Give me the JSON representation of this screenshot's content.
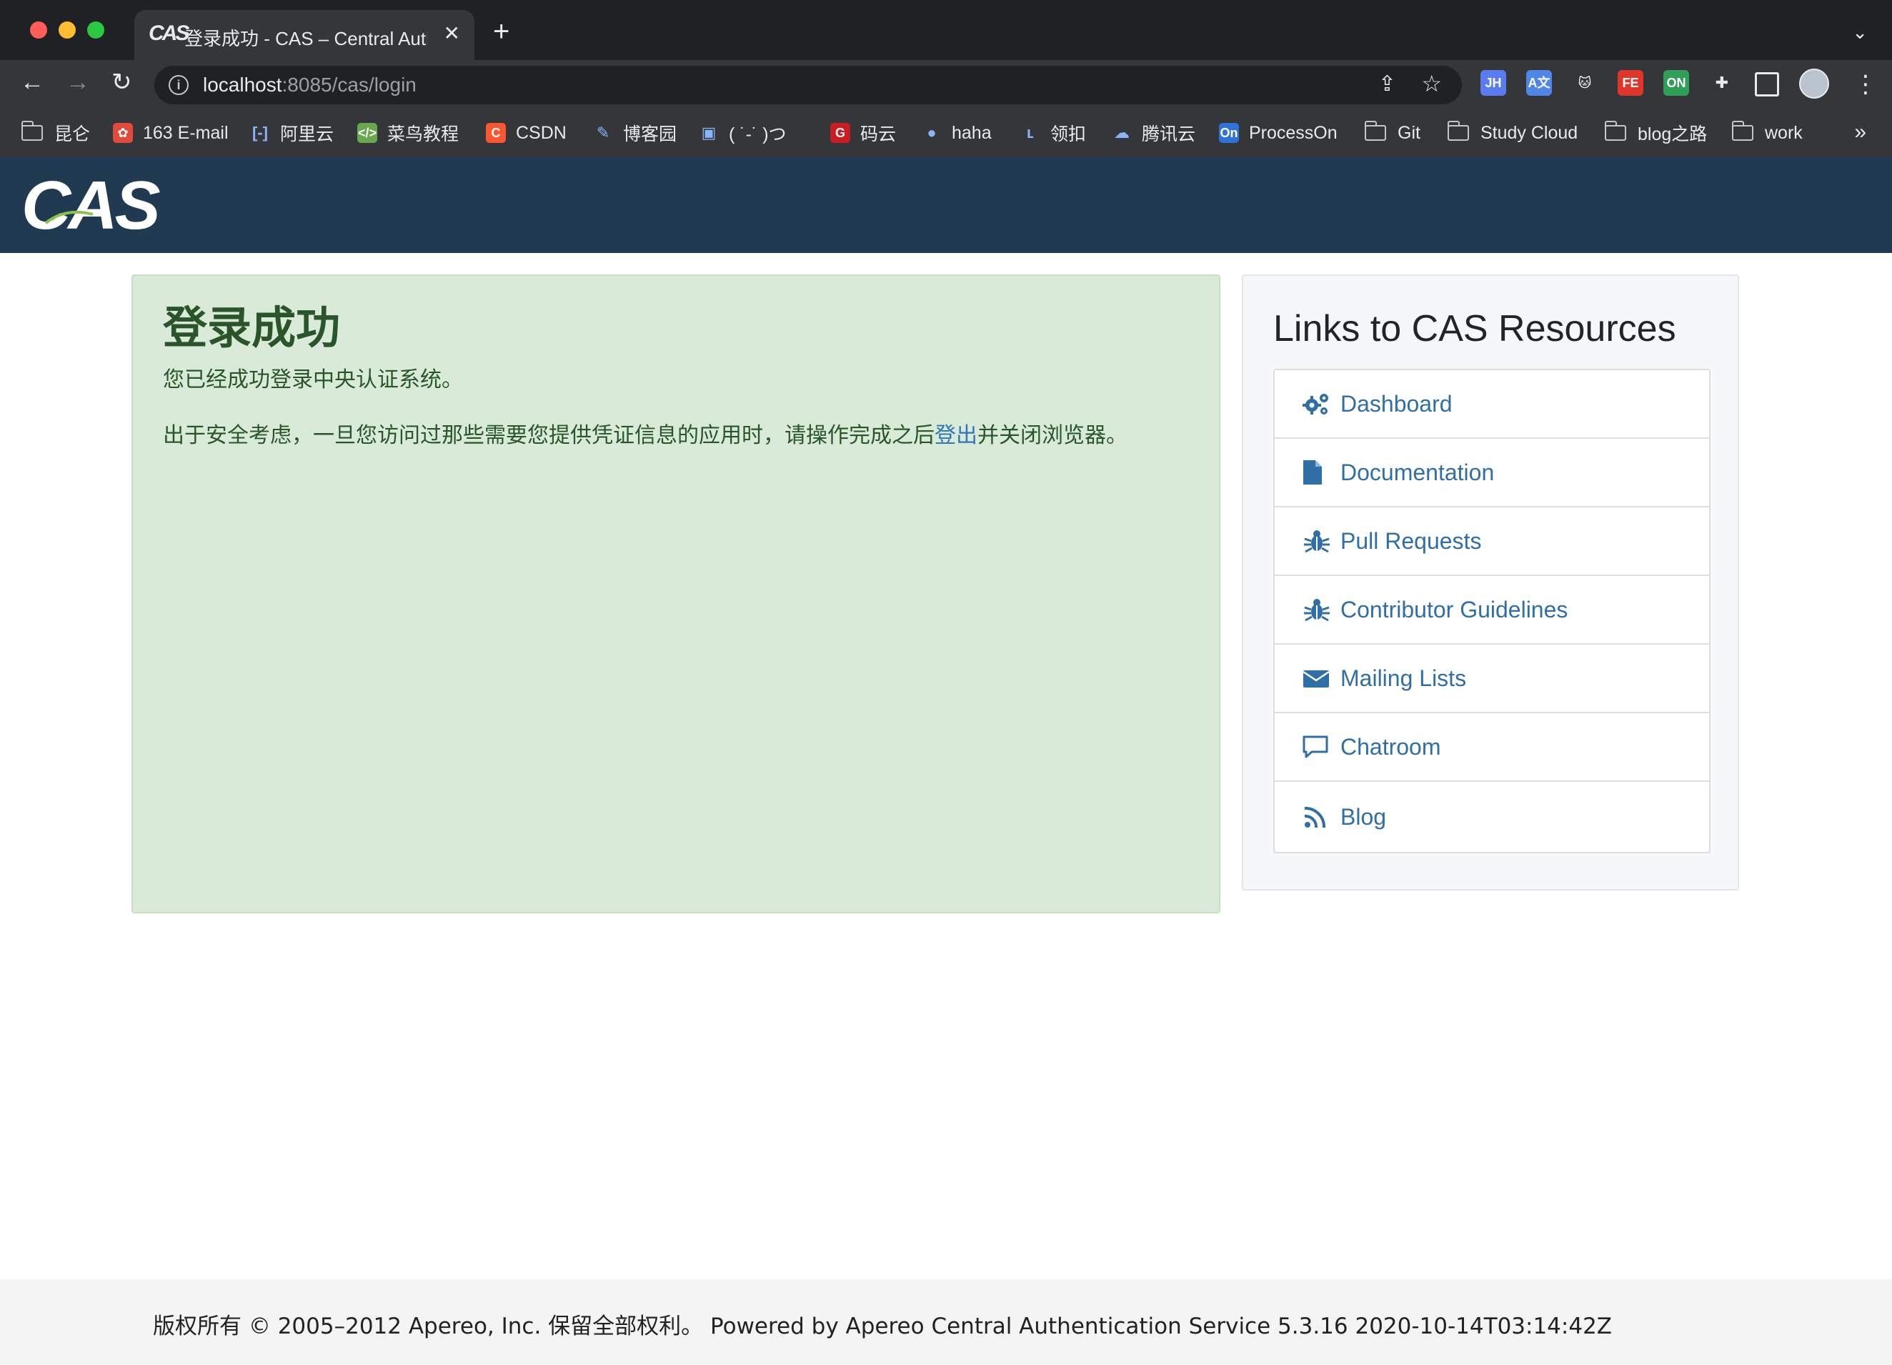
{
  "browser": {
    "tab_title": "登录成功 - CAS – Central Authe",
    "tab_favicon": "CAS",
    "url_host": "localhost",
    "url_rest": ":8085/cas/login",
    "bookmarks": [
      {
        "label": "昆仑",
        "icon": "folder-icon"
      },
      {
        "label": "163 E-mail",
        "icon": "163-icon"
      },
      {
        "label": "阿里云",
        "icon": "aliyun-icon"
      },
      {
        "label": "菜鸟教程",
        "icon": "runoob-icon"
      },
      {
        "label": "CSDN",
        "icon": "csdn-icon"
      },
      {
        "label": "博客园",
        "icon": "cnblogs-icon"
      },
      {
        "label": "( ˙-˙ )つ",
        "icon": "bilibili-icon"
      },
      {
        "label": "码云",
        "icon": "gitee-icon"
      },
      {
        "label": "haha",
        "icon": "github-icon"
      },
      {
        "label": "领扣",
        "icon": "leetcode-icon"
      },
      {
        "label": "腾讯云",
        "icon": "tencent-cloud-icon"
      },
      {
        "label": "ProcessOn",
        "icon": "processon-icon"
      },
      {
        "label": "Git",
        "icon": "folder-icon"
      },
      {
        "label": "Study Cloud",
        "icon": "folder-icon"
      },
      {
        "label": "blog之路",
        "icon": "folder-icon"
      },
      {
        "label": "work",
        "icon": "folder-icon"
      }
    ],
    "extensions": [
      {
        "name": "jh-extension-icon",
        "text": "JH",
        "color": "#5b7cf0"
      },
      {
        "name": "translate-extension-icon",
        "text": "A文",
        "color": "#4f86e8"
      },
      {
        "name": "cat-extension-icon",
        "text": "🐱",
        "color": "#35363a"
      },
      {
        "name": "fe-extension-icon",
        "text": "FE",
        "color": "#e0352b"
      },
      {
        "name": "on-extension-icon",
        "text": "ON",
        "color": "#2f9e57"
      }
    ]
  },
  "cas": {
    "logo": "CAS",
    "success": {
      "title": "登录成功",
      "message": "您已经成功登录中央认证系统。",
      "security_prefix": "出于安全考虑，一旦您访问过那些需要您提供凭证信息的应用时，请操作完成之后",
      "logout_link": "登出",
      "security_suffix": "并关闭浏览器。"
    },
    "links_panel": {
      "title": "Links to CAS Resources",
      "items": [
        {
          "label": "Dashboard",
          "icon": "cogs-icon"
        },
        {
          "label": "Documentation",
          "icon": "file-icon"
        },
        {
          "label": "Pull Requests",
          "icon": "bug-icon"
        },
        {
          "label": "Contributor Guidelines",
          "icon": "bug-icon"
        },
        {
          "label": "Mailing Lists",
          "icon": "envelope-icon"
        },
        {
          "label": "Chatroom",
          "icon": "comment-icon"
        },
        {
          "label": "Blog",
          "icon": "rss-icon"
        }
      ]
    },
    "footer": {
      "text": "版权所有 © 2005–2012 Apereo, Inc. 保留全部权利。 Powered by Apereo Central Authentication Service 5.3.16 2020-10-14T03:14:42Z"
    }
  },
  "colors": {
    "header_bg": "#1f3a51",
    "success_bg": "#d9ead9",
    "success_text": "#2a552a",
    "link_color": "#2f6fa6"
  }
}
